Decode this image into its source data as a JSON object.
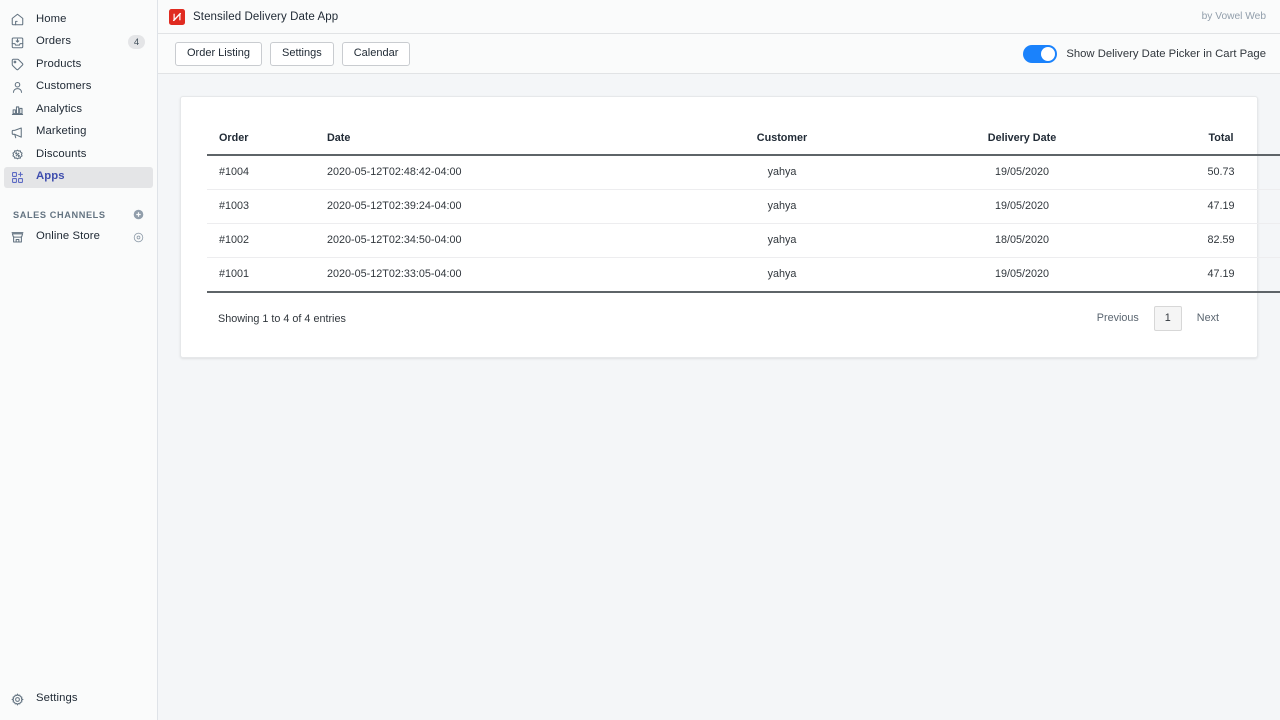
{
  "sidebar": {
    "items": [
      {
        "label": "Home",
        "icon": "home-icon",
        "badge": null,
        "active": false
      },
      {
        "label": "Orders",
        "icon": "orders-icon",
        "badge": "4",
        "active": false
      },
      {
        "label": "Products",
        "icon": "products-icon",
        "badge": null,
        "active": false
      },
      {
        "label": "Customers",
        "icon": "customers-icon",
        "badge": null,
        "active": false
      },
      {
        "label": "Analytics",
        "icon": "analytics-icon",
        "badge": null,
        "active": false
      },
      {
        "label": "Marketing",
        "icon": "marketing-icon",
        "badge": null,
        "active": false
      },
      {
        "label": "Discounts",
        "icon": "discounts-icon",
        "badge": null,
        "active": false
      },
      {
        "label": "Apps",
        "icon": "apps-icon",
        "badge": null,
        "active": true
      }
    ],
    "sales_channels": {
      "title": "SALES CHANNELS",
      "add_icon": "plus-circle-icon",
      "items": [
        {
          "label": "Online Store",
          "icon": "storefront-icon",
          "trailing_icon": "eye-icon"
        }
      ]
    },
    "footer": {
      "label": "Settings",
      "icon": "gear-icon"
    }
  },
  "topbar": {
    "logo_icon": "app-logo-icon",
    "title": "Stensiled Delivery Date App",
    "author": "by Vowel Web"
  },
  "toolbar": {
    "tabs": [
      {
        "label": "Order Listing"
      },
      {
        "label": "Settings"
      },
      {
        "label": "Calendar"
      }
    ],
    "toggle": {
      "label": "Show Delivery Date Picker in Cart Page",
      "on": true,
      "color": "#1a82fc"
    }
  },
  "table": {
    "columns": [
      "Order",
      "Date",
      "Customer",
      "Delivery Date",
      "Total"
    ],
    "rows": [
      {
        "order": "#1004",
        "date": "2020-05-12T02:48:42-04:00",
        "customer": "yahya",
        "delivery_date": "19/05/2020",
        "total": "50.73"
      },
      {
        "order": "#1003",
        "date": "2020-05-12T02:39:24-04:00",
        "customer": "yahya",
        "delivery_date": "19/05/2020",
        "total": "47.19"
      },
      {
        "order": "#1002",
        "date": "2020-05-12T02:34:50-04:00",
        "customer": "yahya",
        "delivery_date": "18/05/2020",
        "total": "82.59"
      },
      {
        "order": "#1001",
        "date": "2020-05-12T02:33:05-04:00",
        "customer": "yahya",
        "delivery_date": "19/05/2020",
        "total": "47.19"
      }
    ],
    "entries_info": "Showing 1 to 4 of 4 entries",
    "pagination": {
      "previous": "Previous",
      "pages": [
        "1"
      ],
      "current_page": "1",
      "next": "Next"
    }
  },
  "colors": {
    "accent": "#5c6ac4",
    "toggle_on": "#1a82fc",
    "app_logo_bg": "#e02b20",
    "page_bg": "#f4f6f8"
  }
}
